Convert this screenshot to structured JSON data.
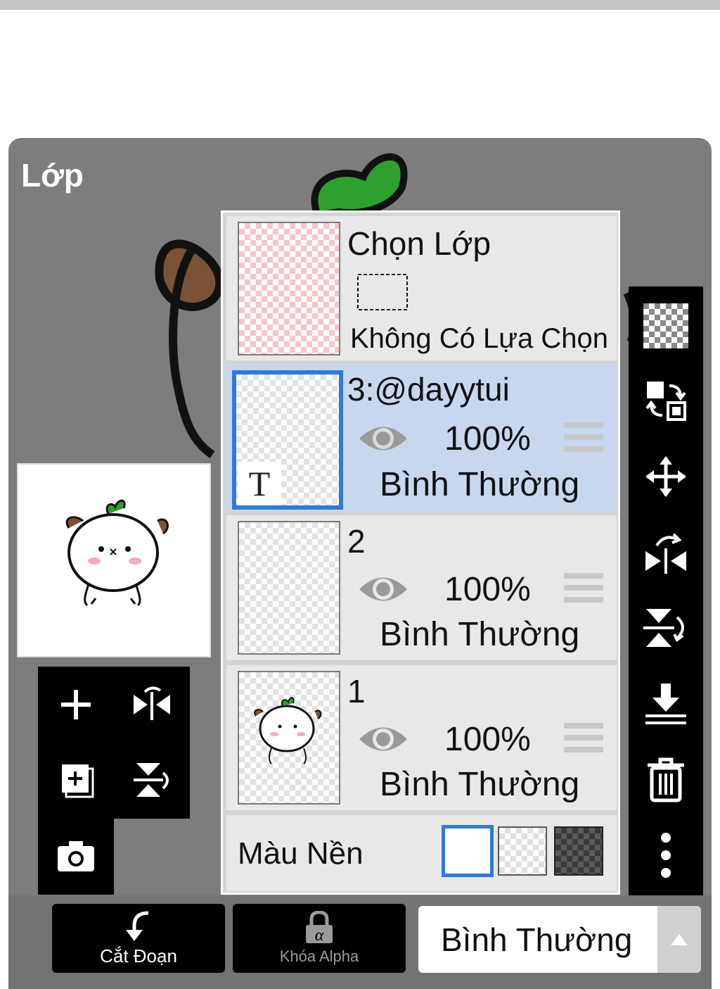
{
  "panel": {
    "title": "Lớp"
  },
  "selection": {
    "title": "Chọn Lớp",
    "status": "Không Có Lựa Chọn"
  },
  "layers": [
    {
      "name": "3:@dayytui",
      "opacity": "100%",
      "mode": "Bình Thường",
      "thumb_text": "T",
      "selected": true
    },
    {
      "name": "2",
      "opacity": "100%",
      "mode": "Bình Thường",
      "selected": false
    },
    {
      "name": "1",
      "opacity": "100%",
      "mode": "Bình Thường",
      "selected": false
    }
  ],
  "background": {
    "label": "Màu Nền",
    "options": [
      "white",
      "transparent",
      "dark-checker"
    ],
    "selected": "white"
  },
  "bottom": {
    "clip_label": "Cắt Đoạn",
    "alpha_label": "Khóa Alpha",
    "blend_mode": "Bình Thường"
  },
  "colors": {
    "accent": "#2f7ad9",
    "selected_row": "#c8d7ee",
    "panel": "#7d7d7d",
    "leaf": "#2ea02e",
    "ear": "#7a5235"
  },
  "icons": {
    "left_tools": [
      "plus-icon",
      "flip-horizontal-icon",
      "add-layer-icon",
      "flip-vertical-icon",
      "camera-icon"
    ],
    "sidebar": [
      "transparency-icon",
      "swap-layer-icon",
      "move-icon",
      "rotate-flip-icon",
      "flip-vertical-icon",
      "merge-down-icon",
      "trash-icon",
      "more-icon"
    ]
  }
}
